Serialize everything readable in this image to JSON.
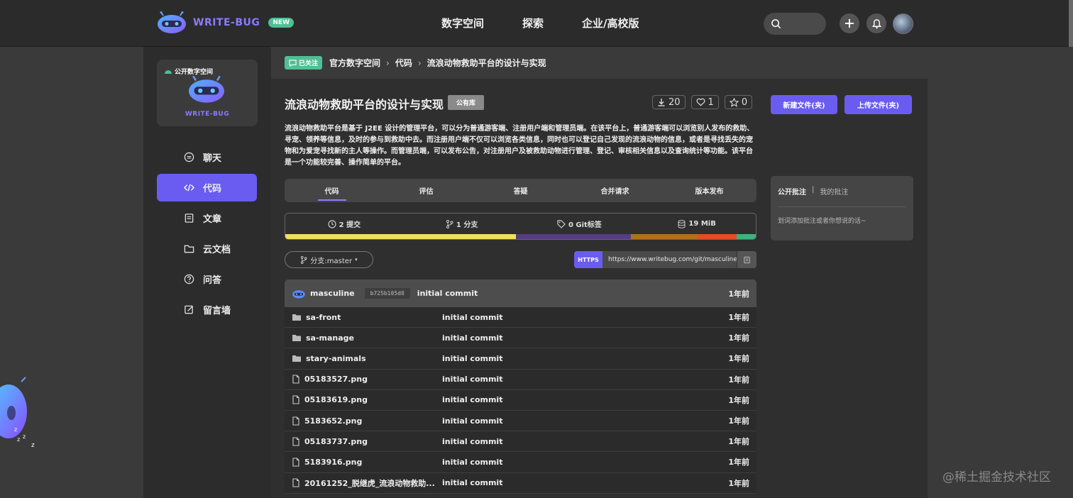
{
  "header": {
    "brand": "WRITE-BUG",
    "brand_badge": "NEW",
    "nav": [
      "数字空间",
      "探索",
      "企业/高校版"
    ]
  },
  "sidebar": {
    "space_tag": "公开数字空间",
    "space_name": "WRITE-BUG",
    "items": [
      {
        "label": "聊天",
        "icon": "chat-icon"
      },
      {
        "label": "代码",
        "icon": "code-icon",
        "active": true
      },
      {
        "label": "文章",
        "icon": "article-icon"
      },
      {
        "label": "云文档",
        "icon": "folder-icon"
      },
      {
        "label": "问答",
        "icon": "question-icon"
      },
      {
        "label": "留言墙",
        "icon": "edit-icon"
      }
    ]
  },
  "breadcrumb": {
    "follow_label": "已关注",
    "items": [
      "官方数字空间",
      "代码",
      "流浪动物救助平台的设计与实现"
    ]
  },
  "repo": {
    "title": "流浪动物救助平台的设计与实现",
    "badge": "公有库",
    "downloads": "20",
    "likes": "1",
    "stars": "0",
    "description": "流浪动物救助平台是基于 J2EE 设计的管理平台，可以分为普通游客端、注册用户端和管理员端。在该平台上，普通游客端可以浏览别人发布的救助、寻宠、领养等信息，及时的参与到救助中去。而注册用户端不仅可以浏览各类信息，同时也可以登记自己发现的流浪动物的信息，或者是寻找丢失的宠物和为爱宠寻找新的主人等操作。而管理员端，可以发布公告，对注册用户及被救助动物进行管理、登记、审核相关信息以及查询统计等功能。该平台是一个功能较完善、操作简单的平台。"
  },
  "tabs": [
    "代码",
    "评估",
    "答疑",
    "合并请求",
    "版本发布"
  ],
  "repo_stats": {
    "commits": "2 提交",
    "branches": "1 分支",
    "tags": "0 Git标签",
    "size": "19 MiB",
    "language_bar": [
      {
        "color": "#f1e05a",
        "fraction": 0.49
      },
      {
        "color": "#563d7c",
        "fraction": 0.245
      },
      {
        "color": "#b07219",
        "fraction": 0.14
      },
      {
        "color": "#e34c26",
        "fraction": 0.085
      },
      {
        "color": "#3fb27f",
        "fraction": 0.04
      }
    ]
  },
  "branch": {
    "label": "分支:master"
  },
  "clone": {
    "protocol": "HTTPS",
    "url": "https://www.writebug.com/git/masculine"
  },
  "files": {
    "head": {
      "user": "masculine",
      "hash": "b725b105d8",
      "message": "initial commit",
      "time": "1年前"
    },
    "rows": [
      {
        "name": "sa-front",
        "type": "folder",
        "message": "initial commit",
        "time": "1年前"
      },
      {
        "name": "sa-manage",
        "type": "folder",
        "message": "initial commit",
        "time": "1年前"
      },
      {
        "name": "stary-animals",
        "type": "folder",
        "message": "initial commit",
        "time": "1年前"
      },
      {
        "name": "05183527.png",
        "type": "file",
        "message": "initial commit",
        "time": "1年前"
      },
      {
        "name": "05183619.png",
        "type": "file",
        "message": "initial commit",
        "time": "1年前"
      },
      {
        "name": "5183652.png",
        "type": "file",
        "message": "initial commit",
        "time": "1年前"
      },
      {
        "name": "05183737.png",
        "type": "file",
        "message": "initial commit",
        "time": "1年前"
      },
      {
        "name": "5183916.png",
        "type": "file",
        "message": "initial commit",
        "time": "1年前"
      },
      {
        "name": "20161252_脱继虎_流浪动物救助...",
        "type": "file",
        "message": "initial commit",
        "time": "1年前"
      }
    ]
  },
  "actions": {
    "new_file": "新建文件(夹)",
    "upload_file": "上传文件(夹)"
  },
  "comments": {
    "tab_public": "公开批注",
    "divider": "|",
    "tab_mine": "我的批注",
    "hint": "划词添加批注或者你想说的话~"
  },
  "watermark": "@稀土掘金技术社区"
}
